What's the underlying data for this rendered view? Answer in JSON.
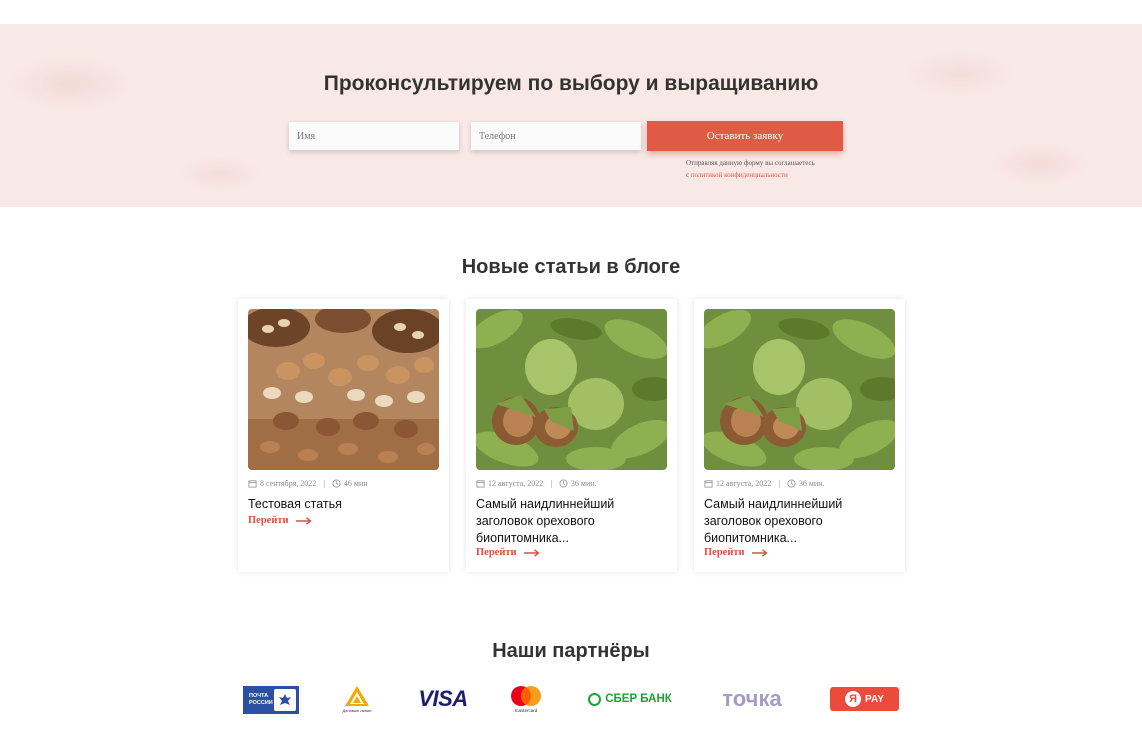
{
  "consultation": {
    "title": "Проконсультируем по выбору и выращиванию",
    "name_placeholder": "Имя",
    "phone_placeholder": "Телефон",
    "submit_label": "Оставить заявку",
    "consent_text": "Отправляя данную форму вы соглашаетесь",
    "consent_prefix": "с",
    "consent_link": "политикой конфиденциальности"
  },
  "blog": {
    "title": "Новые статьи в блоге",
    "posts": [
      {
        "date": "8 сентября, 2022",
        "read_time": "46 мин",
        "title": "Тестовая статья",
        "link": "Перейти",
        "image": "mixed-nuts-photo"
      },
      {
        "date": "12 августа, 2022",
        "read_time": "36 мин.",
        "title": "Самый наидлиннейший заголовок орехового биопитомника...",
        "link": "Перейти",
        "image": "walnuts-on-tree-photo"
      },
      {
        "date": "12 августа, 2022",
        "read_time": "36 мин.",
        "title": "Самый наидлиннейший заголовок орехового биопитомника...",
        "link": "Перейти",
        "image": "walnuts-on-tree-photo"
      }
    ]
  },
  "partners": {
    "title": "Наши партнёры",
    "logos": [
      {
        "name": "pochta-rossii",
        "text": "ПОЧТА РОССИИ"
      },
      {
        "name": "delovye-linii",
        "text": "Деловые линии"
      },
      {
        "name": "visa",
        "text": "VISA"
      },
      {
        "name": "mastercard",
        "text": "mastercard"
      },
      {
        "name": "sberbank",
        "text": "СБЕР БАНК"
      },
      {
        "name": "tochka",
        "text": "точка"
      },
      {
        "name": "yandex-pay",
        "text": "Я",
        "text2": "PAY"
      }
    ]
  },
  "colors": {
    "accent": "#e05a45",
    "consult_bg": "#f9e9e6",
    "link": "#d2543e"
  }
}
